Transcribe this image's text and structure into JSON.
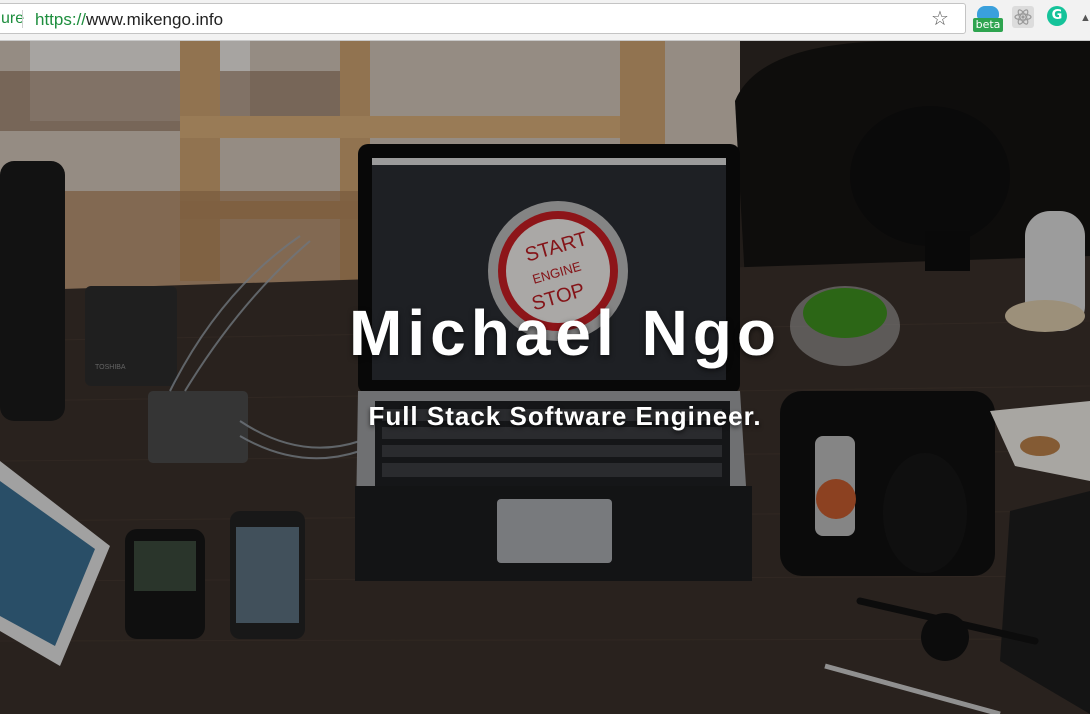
{
  "browser": {
    "secure_label": "ure",
    "url_scheme": "https://",
    "url_rest": "www.mikengo.info",
    "extensions": {
      "beta_badge": "beta",
      "grammarly_letter": "G"
    }
  },
  "hero": {
    "title": "Michael Ngo",
    "subtitle": "Full Stack Software Engineer.",
    "laptop_screen": {
      "line1": "START",
      "line2": "ENGINE",
      "line3": "STOP"
    },
    "drive_brand": "TOSHIBA"
  },
  "colors": {
    "secure_green": "#1e8e3e",
    "hero_text": "#ffffff",
    "desk": "#3a302a"
  }
}
